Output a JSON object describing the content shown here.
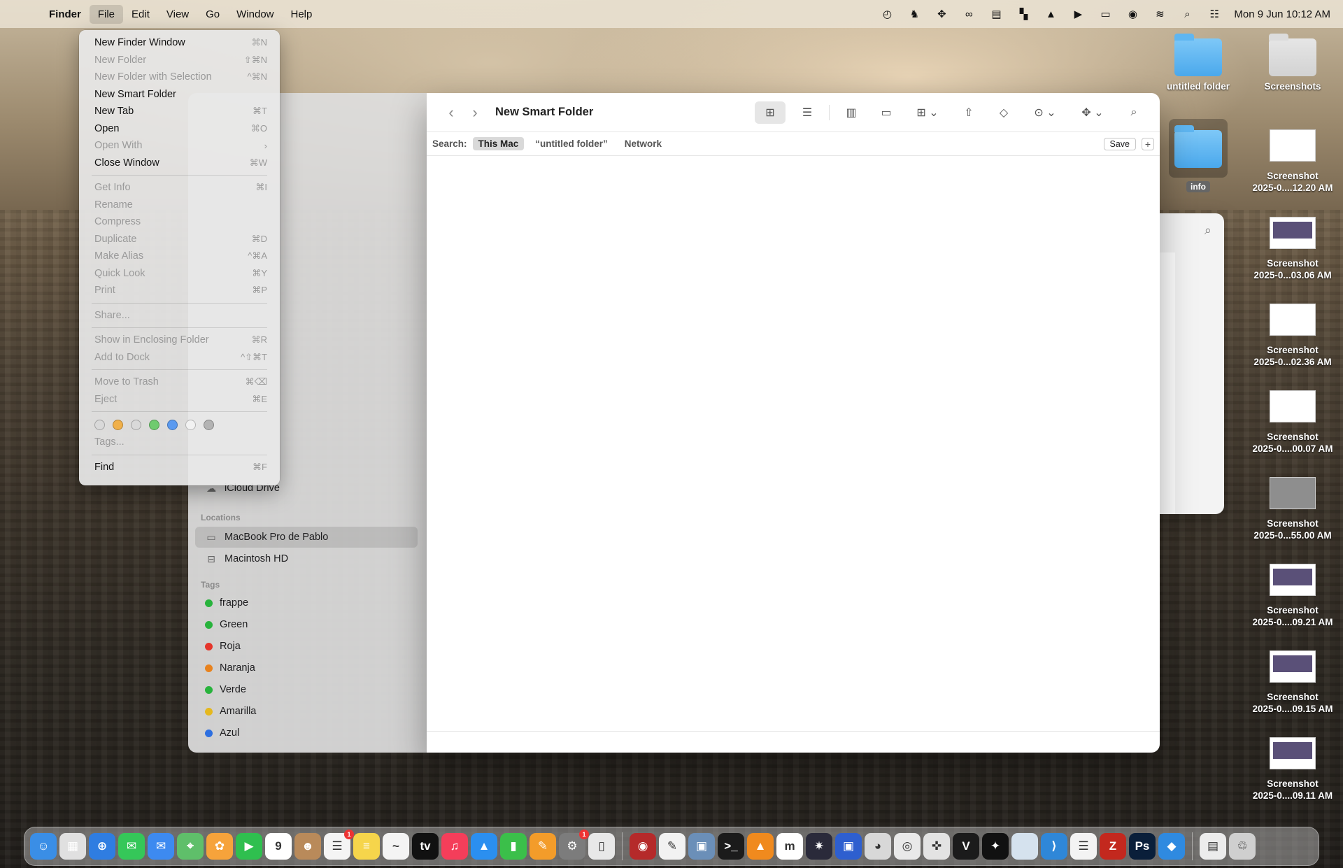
{
  "menubar": {
    "apple": "",
    "app": "Finder",
    "menus": [
      "File",
      "Edit",
      "View",
      "Go",
      "Window",
      "Help"
    ],
    "status_icons": [
      "backup-icon",
      "person-icon",
      "dropbox-icon",
      "creative-cloud-icon",
      "clipboard-icon",
      "grid-icon",
      "vlc-icon",
      "play-icon",
      "battery-icon",
      "user-icon",
      "wifi-icon",
      "search-icon",
      "control-center-icon"
    ],
    "clock": "Mon 9 Jun  10:12 AM"
  },
  "file_menu": {
    "groups": [
      [
        {
          "label": "New Finder Window",
          "shortcut": "⌘N",
          "enabled": true
        },
        {
          "label": "New Folder",
          "shortcut": "⇧⌘N",
          "enabled": false
        },
        {
          "label": "New Folder with Selection",
          "shortcut": "^⌘N",
          "enabled": false
        },
        {
          "label": "New Smart Folder",
          "shortcut": "",
          "enabled": true
        },
        {
          "label": "New Tab",
          "shortcut": "⌘T",
          "enabled": true
        },
        {
          "label": "Open",
          "shortcut": "⌘O",
          "enabled": true
        },
        {
          "label": "Open With",
          "shortcut": "›",
          "enabled": false
        },
        {
          "label": "Close Window",
          "shortcut": "⌘W",
          "enabled": true
        }
      ],
      [
        {
          "label": "Get Info",
          "shortcut": "⌘I",
          "enabled": false
        },
        {
          "label": "Rename",
          "shortcut": "",
          "enabled": false
        },
        {
          "label": "Compress",
          "shortcut": "",
          "enabled": false
        },
        {
          "label": "Duplicate",
          "shortcut": "⌘D",
          "enabled": false
        },
        {
          "label": "Make Alias",
          "shortcut": "^⌘A",
          "enabled": false
        },
        {
          "label": "Quick Look",
          "shortcut": "⌘Y",
          "enabled": false
        },
        {
          "label": "Print",
          "shortcut": "⌘P",
          "enabled": false
        }
      ],
      [
        {
          "label": "Share...",
          "shortcut": "",
          "enabled": false
        }
      ],
      [
        {
          "label": "Show in Enclosing Folder",
          "shortcut": "⌘R",
          "enabled": false
        },
        {
          "label": "Add to Dock",
          "shortcut": "^⇧⌘T",
          "enabled": false
        }
      ],
      [
        {
          "label": "Move to Trash",
          "shortcut": "⌘⌫",
          "enabled": false
        },
        {
          "label": "Eject",
          "shortcut": "⌘E",
          "enabled": false
        }
      ]
    ],
    "tag_colors": [
      "#d9d9d9",
      "#f0b04a",
      "#d9d9d9",
      "#6fcb6f",
      "#5a9af0",
      "#f2f2f2",
      "#b3b3b3"
    ],
    "tags_label": "Tags...",
    "find": {
      "label": "Find",
      "shortcut": "⌘F"
    }
  },
  "sidebar": {
    "icloud_drive": "iCloud Drive",
    "locations_header": "Locations",
    "locations": [
      {
        "label": "MacBook Pro de Pablo",
        "icon": "laptop-icon",
        "selected": true
      },
      {
        "label": "Macintosh HD",
        "icon": "disk-icon",
        "selected": false
      }
    ],
    "tags_header": "Tags",
    "tags": [
      {
        "label": "frappe",
        "color": "#28b33c"
      },
      {
        "label": "Green",
        "color": "#28b33c"
      },
      {
        "label": "Roja",
        "color": "#e5352b"
      },
      {
        "label": "Naranja",
        "color": "#e8821e"
      },
      {
        "label": "Verde",
        "color": "#28b33c"
      },
      {
        "label": "Amarilla",
        "color": "#e5b81e"
      },
      {
        "label": "Azul",
        "color": "#2d6fe0"
      }
    ]
  },
  "finder": {
    "title": "New Smart Folder",
    "search_label": "Search:",
    "scopes": [
      {
        "label": "This Mac",
        "active": true
      },
      {
        "label": "“untitled folder”",
        "active": false
      },
      {
        "label": "Network",
        "active": false
      }
    ],
    "save": "Save",
    "plus": "+"
  },
  "desktop": {
    "items": [
      {
        "label": "untitled folder",
        "kind": "folder"
      },
      {
        "label": "Screenshots",
        "kind": "folder-plain"
      },
      {
        "label": "info",
        "kind": "folder-selected"
      },
      {
        "label": "Screenshot\n2025-0....12.20 AM",
        "kind": "thumb"
      },
      {
        "label": "Screenshot\n2025-0...03.06 AM",
        "kind": "thumb-dark"
      },
      {
        "label": "Screenshot\n2025-0...02.36 AM",
        "kind": "thumb"
      },
      {
        "label": "Screenshot\n2025-0....00.07 AM",
        "kind": "thumb"
      },
      {
        "label": "Screenshot\n2025-0...55.00 AM",
        "kind": "thumb-grey"
      },
      {
        "label": "Screenshot\n2025-0....09.21 AM",
        "kind": "thumb-dark"
      },
      {
        "label": "Screenshot\n2025-0....09.15 AM",
        "kind": "thumb-dark"
      },
      {
        "label": "Screenshot\n2025-0....09.11 AM",
        "kind": "thumb-dark"
      }
    ]
  },
  "dock": {
    "apps": [
      {
        "name": "finder-icon",
        "color": "#3a8ee6",
        "glyph": "☺"
      },
      {
        "name": "launchpad-icon",
        "color": "#e0e0e0",
        "glyph": "▦"
      },
      {
        "name": "safari-icon",
        "color": "#2f7de1",
        "glyph": "⊕"
      },
      {
        "name": "messages-icon",
        "color": "#35c759",
        "glyph": "✉"
      },
      {
        "name": "mail-icon",
        "color": "#3d8af0",
        "glyph": "✉"
      },
      {
        "name": "maps-icon",
        "color": "#5fbf6a",
        "glyph": "⌖"
      },
      {
        "name": "photos-icon",
        "color": "#f6a33b",
        "glyph": "✿"
      },
      {
        "name": "facetime-icon",
        "color": "#2fbf4f",
        "glyph": "▶"
      },
      {
        "name": "calendar-icon",
        "color": "#ffffff",
        "glyph": "9",
        "dark": true
      },
      {
        "name": "contacts-icon",
        "color": "#b98a5a",
        "glyph": "☻"
      },
      {
        "name": "reminders-icon",
        "color": "#f4f4f4",
        "glyph": "☰",
        "dark": true,
        "badge": "1"
      },
      {
        "name": "notes-icon",
        "color": "#f6d54b",
        "glyph": "≡"
      },
      {
        "name": "freeform-icon",
        "color": "#f4f4f4",
        "glyph": "~",
        "dark": true
      },
      {
        "name": "tv-icon",
        "color": "#111111",
        "glyph": "tv"
      },
      {
        "name": "music-icon",
        "color": "#f43e5a",
        "glyph": "♫"
      },
      {
        "name": "keynote-icon",
        "color": "#2b8ff0",
        "glyph": "▲"
      },
      {
        "name": "numbers-icon",
        "color": "#3bbf4a",
        "glyph": "▮"
      },
      {
        "name": "pages-icon",
        "color": "#f39c2a",
        "glyph": "✎"
      },
      {
        "name": "system-settings-icon",
        "color": "#7c7c7c",
        "glyph": "⚙",
        "badge": "1"
      },
      {
        "name": "iphone-mirroring-icon",
        "color": "#e8e8e8",
        "glyph": "▯",
        "dark": true
      },
      {
        "name": "photo-booth-icon",
        "color": "#b52a2a",
        "glyph": "◉"
      },
      {
        "name": "textedit-icon",
        "color": "#f2f2f2",
        "glyph": "✎",
        "dark": true
      },
      {
        "name": "preview-icon",
        "color": "#6b8fb8",
        "glyph": "▣"
      },
      {
        "name": "terminal-icon",
        "color": "#1b1b1b",
        "glyph": ">_"
      },
      {
        "name": "vlc-icon",
        "color": "#f08a1e",
        "glyph": "▲"
      },
      {
        "name": "m-app-icon",
        "color": "#ffffff",
        "glyph": "m",
        "dark": true
      },
      {
        "name": "spark-icon",
        "color": "#2a2a3a",
        "glyph": "✷"
      },
      {
        "name": "app-box-icon",
        "color": "#2e5fcf",
        "glyph": "▣"
      },
      {
        "name": "monkey-icon",
        "color": "#d8d8d8",
        "glyph": "◕",
        "dark": true
      },
      {
        "name": "chrome-icon",
        "color": "#e9e9e9",
        "glyph": "◎",
        "dark": true
      },
      {
        "name": "compass-icon",
        "color": "#e3e3e3",
        "glyph": "✜",
        "dark": true
      },
      {
        "name": "vs-app-icon",
        "color": "#1b1b1b",
        "glyph": "V"
      },
      {
        "name": "mastodon-icon",
        "color": "#111111",
        "glyph": "✦"
      },
      {
        "name": "blank-app-icon",
        "color": "#d5e2ee",
        "glyph": ""
      },
      {
        "name": "vscode-icon",
        "color": "#2f87d8",
        "glyph": "⟩"
      },
      {
        "name": "notepad-icon",
        "color": "#f3f3f3",
        "glyph": "☰",
        "dark": true
      },
      {
        "name": "filezilla-icon",
        "color": "#c3281e",
        "glyph": "Z"
      },
      {
        "name": "photoshop-icon",
        "color": "#0a1f3a",
        "glyph": "Ps"
      },
      {
        "name": "docker-icon",
        "color": "#2f8ae0",
        "glyph": "◆"
      }
    ],
    "right": [
      {
        "name": "document-icon",
        "color": "#ececec",
        "glyph": "▤",
        "dark": true
      },
      {
        "name": "trash-icon",
        "color": "#cfcfcf",
        "glyph": "♲",
        "dark": true
      }
    ]
  }
}
